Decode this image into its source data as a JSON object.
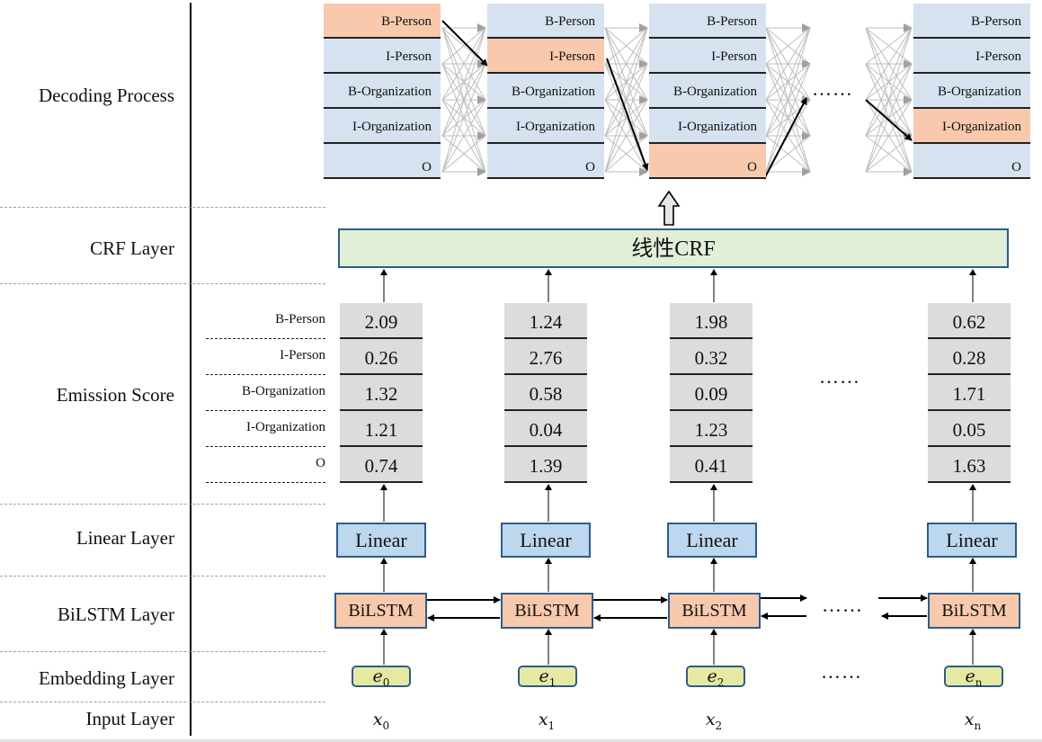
{
  "layers": [
    {
      "id": "decoding",
      "label": "Decoding Process"
    },
    {
      "id": "crf",
      "label": "CRF Layer"
    },
    {
      "id": "emission",
      "label": "Emission Score"
    },
    {
      "id": "linear",
      "label": "Linear Layer"
    },
    {
      "id": "bilstm",
      "label": "BiLSTM Layer"
    },
    {
      "id": "embedding",
      "label": "Embedding Layer"
    },
    {
      "id": "input",
      "label": "Input Layer"
    }
  ],
  "tags": [
    "B-Person",
    "I-Person",
    "B-Organization",
    "I-Organization",
    "O"
  ],
  "decoding": {
    "columns": [
      {
        "selected": "B-Person"
      },
      {
        "selected": "I-Person"
      },
      {
        "selected": "O"
      },
      {
        "selected": "I-Organization"
      }
    ],
    "ellipsis": "……"
  },
  "crf": {
    "label": "线性CRF"
  },
  "emission": {
    "columns": [
      {
        "token": "x0",
        "scores": [
          "2.09",
          "0.26",
          "1.32",
          "1.21",
          "0.74"
        ]
      },
      {
        "token": "x1",
        "scores": [
          "1.24",
          "2.76",
          "0.58",
          "0.04",
          "1.39"
        ]
      },
      {
        "token": "x2",
        "scores": [
          "1.98",
          "0.32",
          "0.09",
          "1.23",
          "0.41"
        ]
      },
      {
        "token": "xn",
        "scores": [
          "0.62",
          "0.28",
          "1.71",
          "0.05",
          "1.63"
        ]
      }
    ],
    "ellipsis": "……"
  },
  "linear": {
    "label": "Linear"
  },
  "bilstm": {
    "label": "BiLSTM",
    "ellipsis": "……"
  },
  "embedding": {
    "items": [
      {
        "base": "e",
        "sub": "0"
      },
      {
        "base": "e",
        "sub": "1"
      },
      {
        "base": "e",
        "sub": "2"
      },
      {
        "base": "e",
        "sub": "n"
      }
    ],
    "ellipsis": "……"
  },
  "input": {
    "items": [
      {
        "base": "x",
        "sub": "0"
      },
      {
        "base": "x",
        "sub": "1"
      },
      {
        "base": "x",
        "sub": "2"
      },
      {
        "base": "x",
        "sub": "n"
      }
    ]
  },
  "colors": {
    "tag_cell": "#d6e2f0",
    "tag_selected": "#f9c9ae",
    "crf_fill": "#e1eed8",
    "linear_fill": "#bcd7ee",
    "bilstm_fill": "#f9c9ae",
    "embedding_fill": "#e5e9a4",
    "emission_fill": "#dcdcdc",
    "box_border": "#2e5c8a"
  }
}
